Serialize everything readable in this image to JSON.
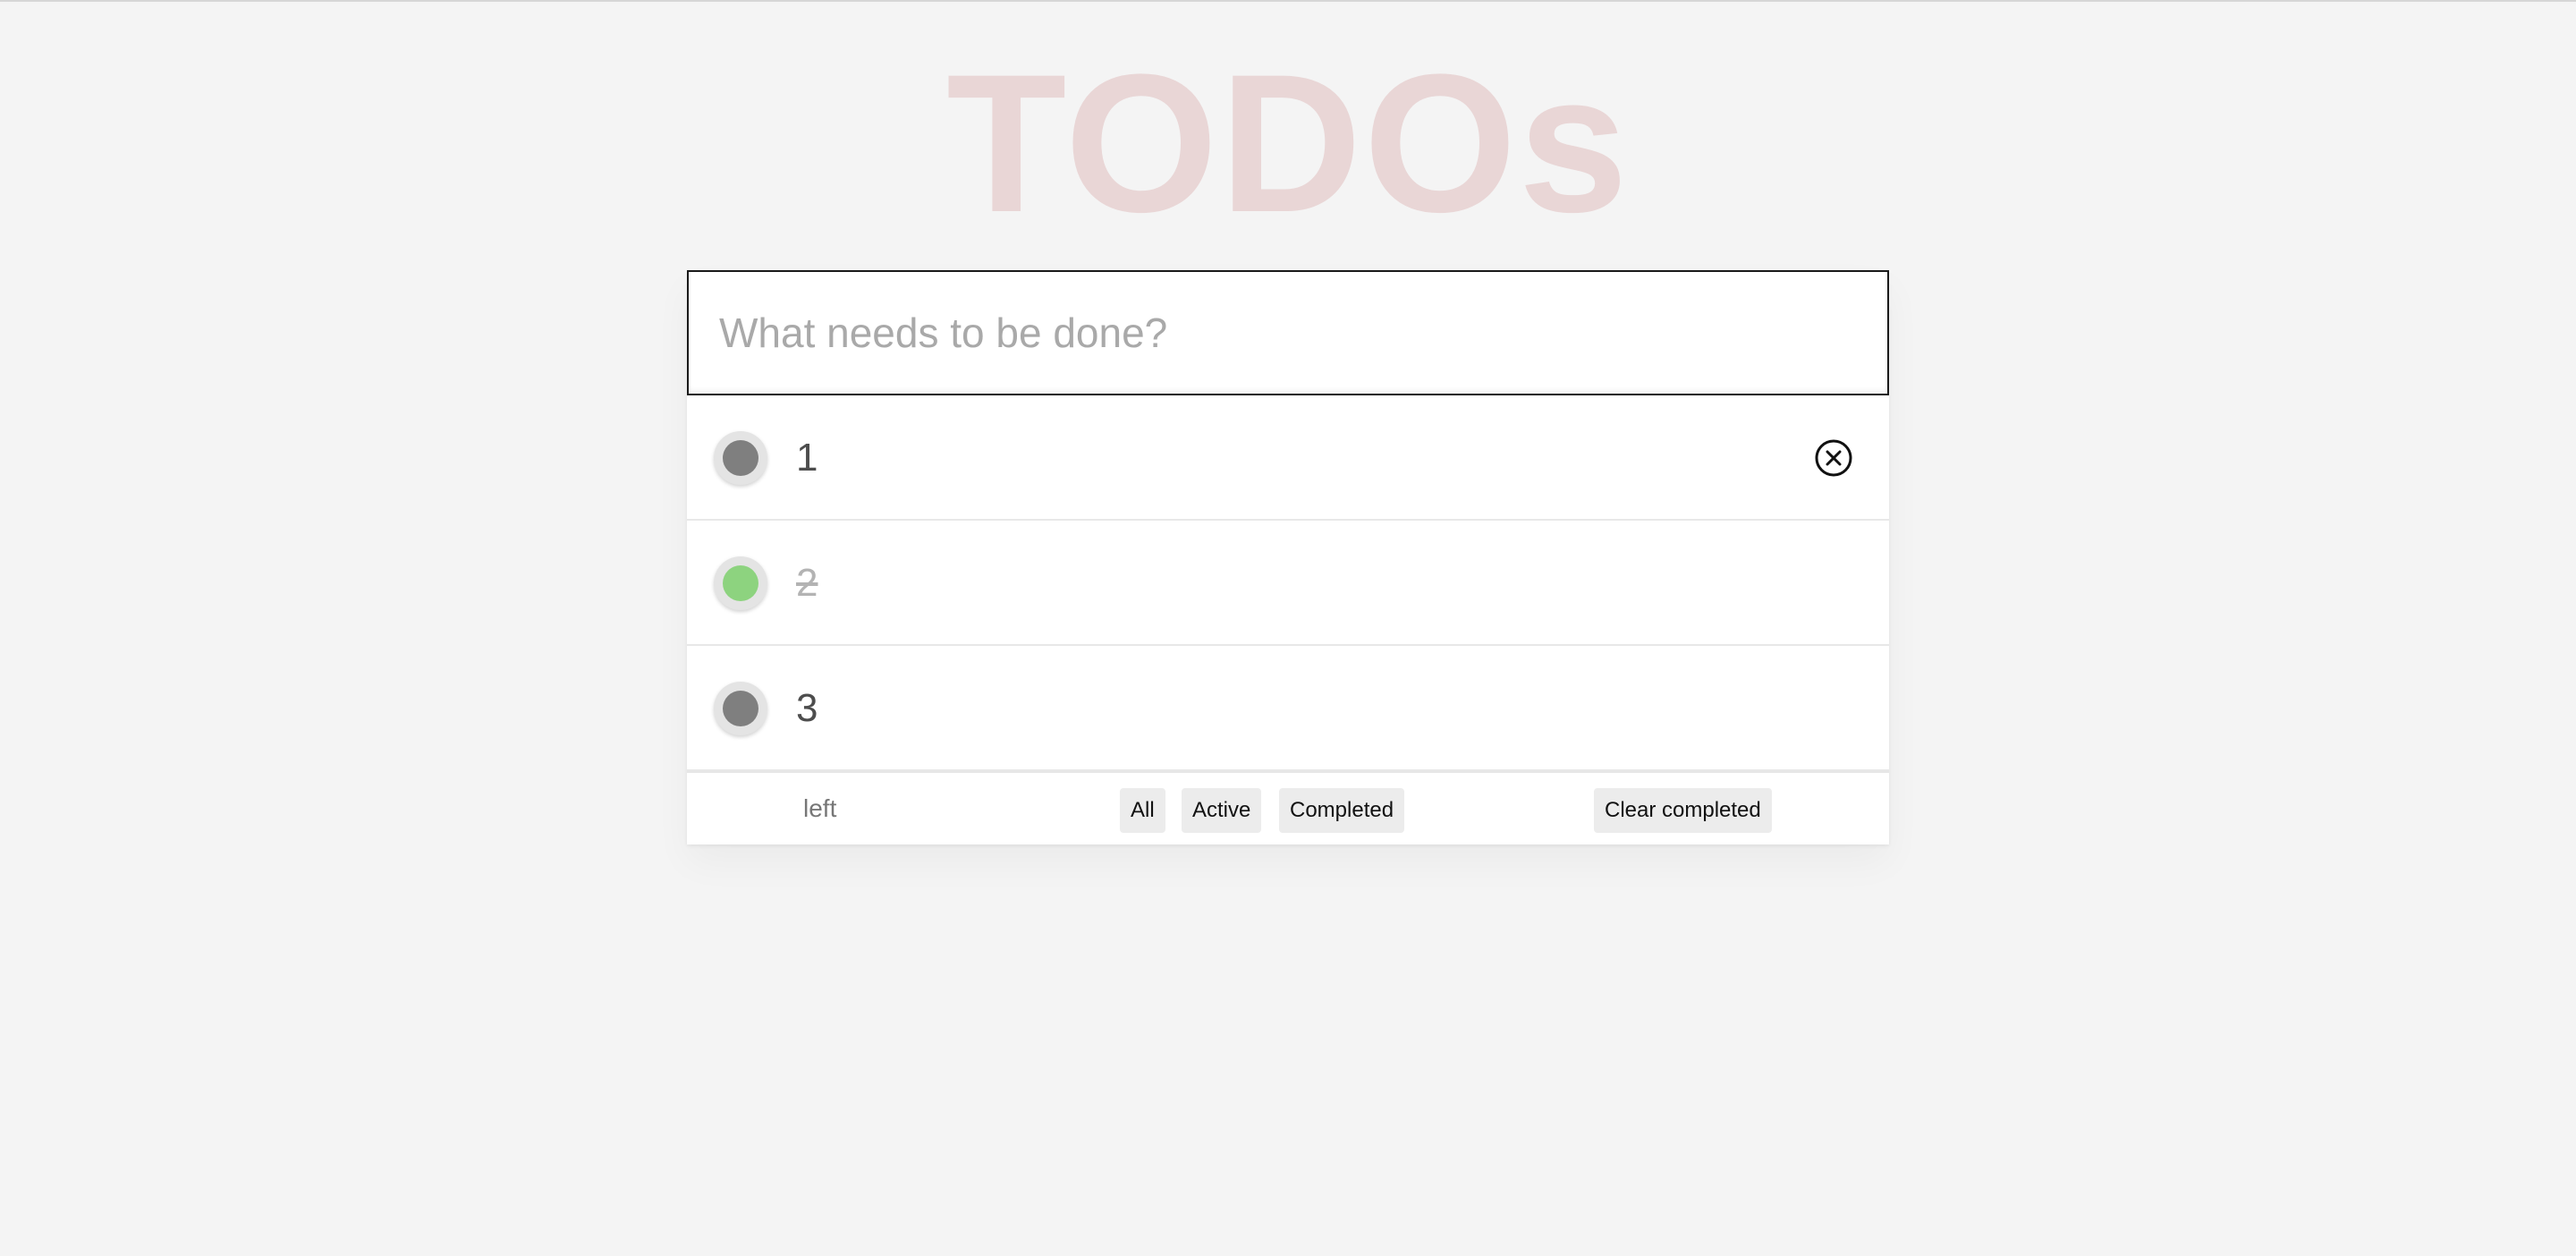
{
  "app": {
    "title": "TODOs"
  },
  "new_todo": {
    "placeholder": "What needs to be done?",
    "value": ""
  },
  "todos": [
    {
      "label": "1",
      "completed": false
    },
    {
      "label": "2",
      "completed": true
    },
    {
      "label": "3",
      "completed": false
    }
  ],
  "footer": {
    "count_text": "left",
    "filters": [
      "All",
      "Active",
      "Completed"
    ],
    "clear_label": "Clear completed"
  },
  "icons": {
    "destroy": "close-circle-icon"
  },
  "colors": {
    "title": "#e9d6d6",
    "completed_dot": "#8dd37f",
    "active_dot": "#7f7f7f",
    "background": "#f4f4f4"
  }
}
